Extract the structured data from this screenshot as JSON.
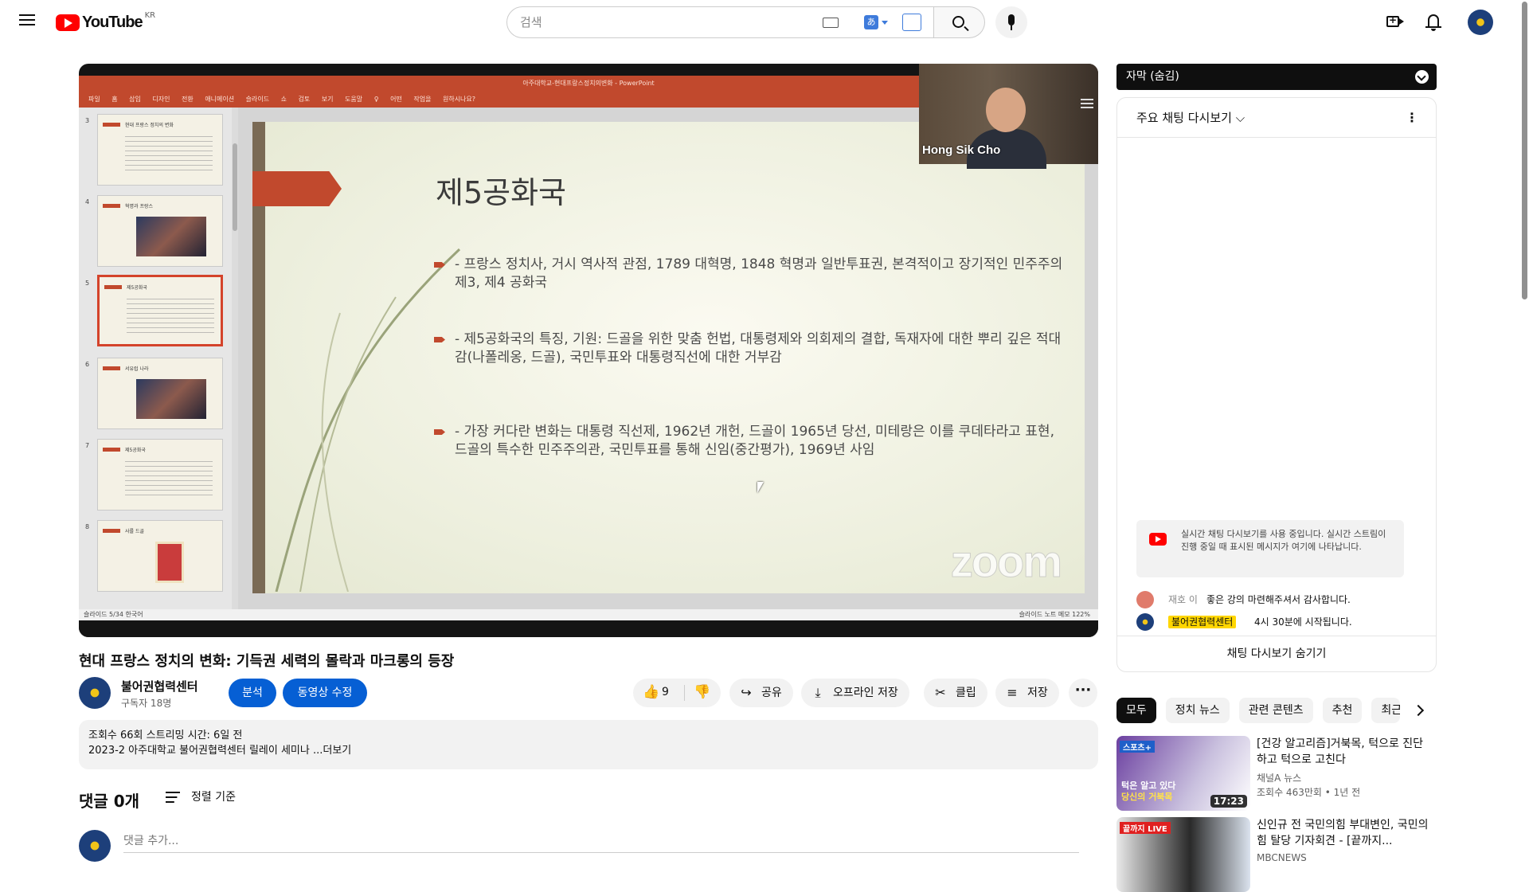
{
  "header": {
    "logo_text": "YouTube",
    "region": "KR",
    "search_placeholder": "검색",
    "translit_label": "あ"
  },
  "player": {
    "ppt_title": "아주대학교-현대프랑스정치의변화 - PowerPoint",
    "ribbon": "파일 홈 삽입 디자인 전환 애니메이션 슬라이드 쇼 검토 보기 도움말 ♀ 어떤 작업을 원하시나요?",
    "thumbnails": [
      {
        "num": "3",
        "title": "현대 프랑스 정치의 변화"
      },
      {
        "num": "4",
        "title": "혁명과 프랑스"
      },
      {
        "num": "5",
        "title": "제5공화국"
      },
      {
        "num": "6",
        "title": "서유럽 나라"
      },
      {
        "num": "7",
        "title": "제5공화국"
      },
      {
        "num": "8",
        "title": "사를 드골"
      }
    ],
    "slide_title": "제5공화국",
    "bullets": [
      "- 프랑스 정치사, 거시 역사적 관점, 1789 대혁명, 1848 혁명과 일반투표권, 본격적이고 장기적인 민주주의 제3, 제4 공화국",
      "- 제5공화국의 특징, 기원: 드골을 위한 맞춤 헌법, 대통령제와 의회제의 결합, 독재자에 대한 뿌리 깊은 적대감(나폴레옹, 드골), 국민투표와 대통령직선에 대한 거부감",
      "- 가장 커다란 변화는 대통령 직선제, 1962년 개헌, 드골이 1965년 당선, 미테랑은 이를 쿠데타라고 표현, 드골의 특수한 민주주의관, 국민투표를 통해 신임(중간평가), 1969년 사임"
    ],
    "zoom_watermark": "zoom",
    "status_left": "슬라이드 5/34   한국어",
    "status_right": "슬라이드 노트   메모   122%",
    "participant_name": "Hong Sik Cho"
  },
  "video": {
    "title": "현대 프랑스 정치의 변화: 기득권 세력의 몰락과 마크롱의 등장",
    "channel_name": "불어권협력센터",
    "subscribers": "구독자 18명",
    "analyze_label": "분석",
    "edit_label": "동영상 수정",
    "like_count": "9",
    "share_label": "공유",
    "download_label": "오프라인 저장",
    "clip_label": "클립",
    "save_label": "저장",
    "more_label": "···",
    "desc_stats": "조회수 66회  스트리밍 시간: 6일 전",
    "desc_text": "2023-2 아주대학교 불어권협력센터 릴레이 세미나 ...더보기"
  },
  "comments": {
    "count_label": "댓글 0개",
    "sort_label": "정렬 기준",
    "input_placeholder": "댓글 추가..."
  },
  "chat": {
    "subtitle_bar": "자막 (숨김)",
    "title": "주요 채팅 다시보기 ⌵",
    "notice": "실시간 채팅 다시보기를 사용 중입니다. 실시간 스트림이 진행 중일 때 표시된 메시지가 여기에 나타납니다.",
    "messages": [
      {
        "author": "재호 이",
        "text": "좋은 강의 마련해주셔서 감사합니다."
      },
      {
        "author": "불어권협력센터",
        "text": "4시 30분에 시작됩니다."
      }
    ],
    "hide_label": "채팅 다시보기 숨기기"
  },
  "chips": [
    "모두",
    "정치 뉴스",
    "관련 콘텐츠",
    "추천",
    "최근"
  ],
  "recommendations": [
    {
      "title": "[건강 알고리즘]거북목, 턱으로 진단하고 턱으로 고친다",
      "channel": "채널A 뉴스",
      "meta": "조회수 463만회 • 1년 전",
      "duration": "17:23",
      "overlay_line1": "턱은 알고 있다",
      "overlay_line2": "당신의 거북목",
      "badge": "스포츠+"
    },
    {
      "title": "신인규 전 국민의힘 부대변인, 국민의힘 탈당 기자회견 - [끝까지...",
      "channel": "MBCNEWS",
      "meta": "",
      "duration": "",
      "overlay_line1": "",
      "overlay_line2": "",
      "badge": "끝까지 LIVE"
    }
  ],
  "colors": {
    "accent_blue": "#065fd4",
    "ppt_orange": "#c1492d",
    "youtube_red": "#ff0000"
  }
}
